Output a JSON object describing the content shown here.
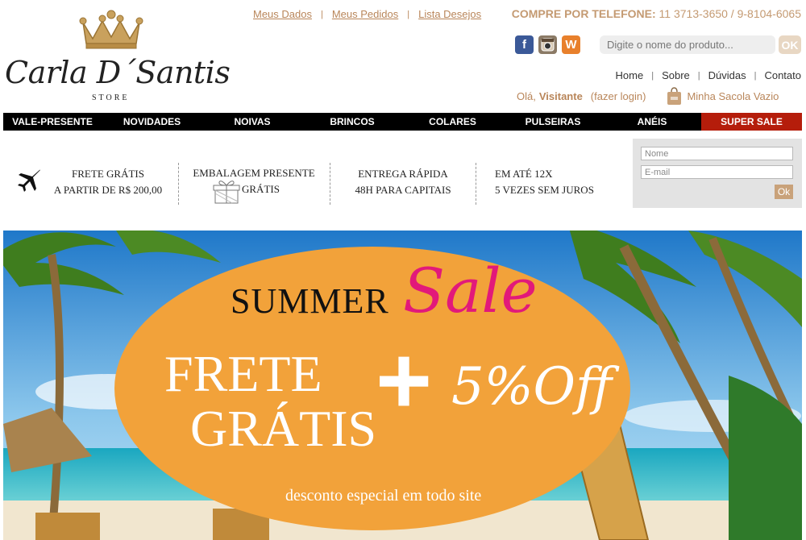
{
  "logo": {
    "brand": "Carla D´Santis",
    "store": "STORE"
  },
  "top_links": [
    "Meus Dados",
    "Meus Pedidos",
    "Lista Desejos"
  ],
  "phone": {
    "label": "COMPRE POR TELEFONE:",
    "numbers": "11 3713-3650 / 9-8104-6065"
  },
  "social": [
    "facebook-icon",
    "instagram-icon",
    "wordpress-icon"
  ],
  "search": {
    "placeholder": "Digite o nome do produto...",
    "button": "OK"
  },
  "util_links": [
    "Home",
    "Sobre",
    "Dúvidas",
    "Contato"
  ],
  "account": {
    "greeting": "Olá,",
    "user": "Visitante",
    "login": "(fazer login)",
    "cart": "Minha Sacola Vazio"
  },
  "nav": [
    "VALE-PRESENTE",
    "NOVIDADES",
    "NOIVAS",
    "BRINCOS",
    "COLARES",
    "PULSEIRAS",
    "ANÉIS",
    "SUPER SALE"
  ],
  "benefits": [
    {
      "line1": "FRETE GRÁTIS",
      "line2": "A PARTIR DE R$ 200,00",
      "icon": "airplane-icon"
    },
    {
      "line1": "EMBALAGEM PRESENTE",
      "line2": "GRÁTIS",
      "icon": "gift-box-icon"
    },
    {
      "line1": "ENTREGA RÁPIDA",
      "line2": "48H PARA CAPITAIS"
    },
    {
      "line1": "EM ATÉ 12X",
      "line2": "5 VEZES SEM JUROS"
    }
  ],
  "newsletter": {
    "name_placeholder": "Nome",
    "email_placeholder": "E-mail",
    "button": "Ok"
  },
  "banner": {
    "summer": "SUMMER",
    "sale": "Sale",
    "frete": "FRETE",
    "gratis": "GRÁTIS",
    "plus": "+",
    "off": "5%Off",
    "description": "desconto especial em todo site"
  },
  "colors": {
    "accent": "#b9865a",
    "nav_bg": "#000000",
    "sale_bg": "#b51d0b",
    "banner_ellipse": "#f2a23a",
    "sale_pink": "#e2197a"
  }
}
